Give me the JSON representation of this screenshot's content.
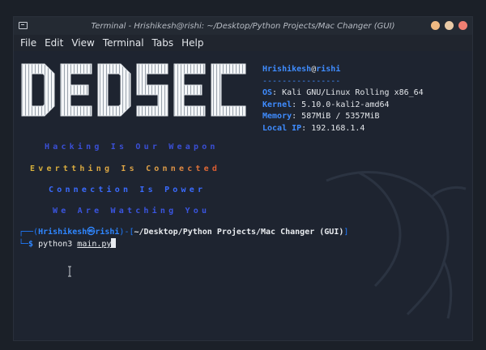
{
  "window": {
    "title": "Terminal - Hrishikesh@rishi: ~/Desktop/Python Projects/Mac Changer (GUI)",
    "controls": [
      {
        "name": "minimize",
        "color": "#f0b982"
      },
      {
        "name": "maximize",
        "color": "#e8c9a6"
      },
      {
        "name": "close",
        "color": "#f07f72"
      }
    ]
  },
  "menu": [
    "File",
    "Edit",
    "View",
    "Terminal",
    "Tabs",
    "Help"
  ],
  "banner": {
    "logo_text": "DEDSEC",
    "taglines": [
      {
        "text": "Hacking Is Our Weapon",
        "color": "#3a4fd6"
      },
      {
        "text": "Evertthing Is Connected",
        "color": "#d8b23b"
      },
      {
        "text": "Connection Is Power",
        "color": "#3a6bff"
      },
      {
        "text": "We Are Watching You",
        "color": "#3a55e0"
      }
    ]
  },
  "sysinfo": {
    "user": "Hrishikesh",
    "at": "@",
    "host": "rishi",
    "separator": "----------------",
    "rows": [
      {
        "key": "OS",
        "value": "Kali GNU/Linux Rolling x86_64"
      },
      {
        "key": "Kernel",
        "value": "5.10.0-kali2-amd64"
      },
      {
        "key": "Memory",
        "value": "587MiB / 5357MiB"
      },
      {
        "key": "Local IP",
        "value": "192.168.1.4"
      }
    ]
  },
  "prompt": {
    "user": "Hrishikesh",
    "host": "rishi",
    "path": "~/Desktop/Python Projects/Mac Changer (GUI)",
    "command": "python3",
    "argument": "main.py"
  },
  "colors": {
    "background": "#1e2430",
    "accent_blue": "#2f86ff"
  }
}
